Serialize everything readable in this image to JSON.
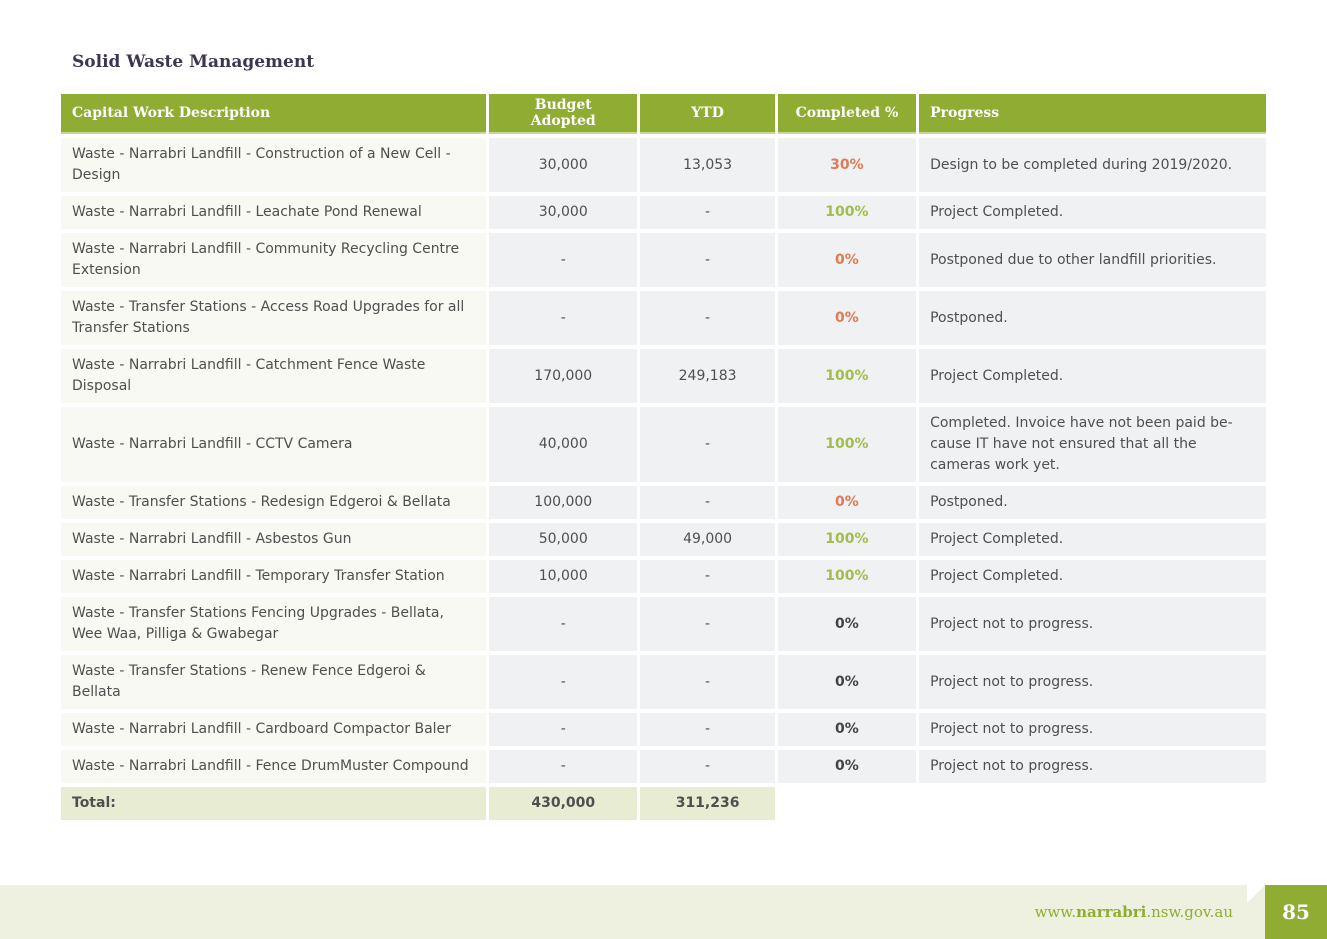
{
  "section_title": "Solid Waste Management",
  "table": {
    "headers": {
      "description": "Capital Work Description",
      "budget": "Budget Adopted",
      "ytd": "YTD",
      "completed": "Completed %",
      "progress": "Progress"
    },
    "rows": [
      {
        "description": "Waste - Narrabri Landfill - Construction of a New Cell - Design",
        "budget": "30,000",
        "ytd": "13,053",
        "completed": "30%",
        "status_color": "orange",
        "progress": "Design to be completed during 2019/2020."
      },
      {
        "description": "Waste - Narrabri Landfill - Leachate Pond Renewal",
        "budget": "30,000",
        "ytd": "-",
        "completed": "100%",
        "status_color": "green",
        "progress": "Project Completed."
      },
      {
        "description": "Waste - Narrabri Landfill - Community Recycling Centre Extension",
        "budget": "-",
        "ytd": "-",
        "completed": "0%",
        "status_color": "orange",
        "progress": "Postponed due to other landfill priorities."
      },
      {
        "description": "Waste - Transfer Stations - Access Road Upgrades for all Transfer Stations",
        "budget": "-",
        "ytd": "-",
        "completed": "0%",
        "status_color": "orange",
        "progress": "Postponed."
      },
      {
        "description": "Waste - Narrabri Landfill - Catchment Fence Waste Disposal",
        "budget": "170,000",
        "ytd": "249,183",
        "completed": "100%",
        "status_color": "green",
        "progress": "Project Completed."
      },
      {
        "description": "Waste - Narrabri Landfill - CCTV Camera",
        "budget": "40,000",
        "ytd": "-",
        "completed": "100%",
        "status_color": "green",
        "progress": "Completed. Invoice have not been paid be-cause IT have not ensured that all the cameras work yet."
      },
      {
        "description": "Waste - Transfer Stations - Redesign Edgeroi & Bellata",
        "budget": "100,000",
        "ytd": "-",
        "completed": "0%",
        "status_color": "orange",
        "progress": "Postponed."
      },
      {
        "description": "Waste - Narrabri Landfill - Asbestos Gun",
        "budget": "50,000",
        "ytd": "49,000",
        "completed": "100%",
        "status_color": "green",
        "progress": "Project Completed."
      },
      {
        "description": "Waste - Narrabri Landfill - Temporary Transfer Station",
        "budget": "10,000",
        "ytd": "-",
        "completed": "100%",
        "status_color": "green",
        "progress": "Project Completed."
      },
      {
        "description": "Waste - Transfer Stations Fencing Upgrades - Bellata, Wee Waa, Pilliga & Gwabegar",
        "budget": "-",
        "ytd": "-",
        "completed": "0%",
        "status_color": "dark",
        "progress": "Project not to progress."
      },
      {
        "description": "Waste - Transfer Stations - Renew Fence Edgeroi & Bellata",
        "budget": "-",
        "ytd": "-",
        "completed": "0%",
        "status_color": "dark",
        "progress": "Project not to progress."
      },
      {
        "description": "Waste - Narrabri Landfill - Cardboard Compactor Baler",
        "budget": "-",
        "ytd": "-",
        "completed": "0%",
        "status_color": "dark",
        "progress": "Project not to progress."
      },
      {
        "description": "Waste - Narrabri Landfill - Fence DrumMuster Compound",
        "budget": "-",
        "ytd": "-",
        "completed": "0%",
        "status_color": "dark",
        "progress": "Project not to progress."
      }
    ],
    "total": {
      "label": "Total:",
      "budget": "430,000",
      "ytd": "311,236"
    }
  },
  "colors": {
    "header_green": "#8fad33",
    "orange": "#e07a52",
    "green": "#a2bd4b",
    "dark": "#444444"
  },
  "footer": {
    "url_prefix": "www.",
    "url_bold": "narrabri",
    "url_suffix": ".nsw.gov.au",
    "page_number": "85"
  }
}
